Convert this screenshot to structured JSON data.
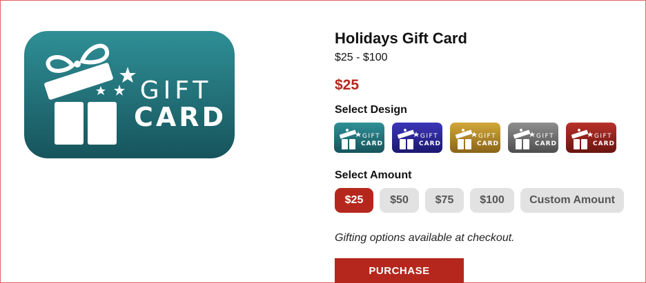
{
  "product": {
    "title": "Holidays Gift Card",
    "price_range": "$25 - $100",
    "selected_price": "$25"
  },
  "card_text": {
    "line1": "GIFT",
    "line2": "CARD"
  },
  "design_section": {
    "label": "Select Design",
    "designs": [
      {
        "name": "teal",
        "color_top": "#2f8f96",
        "color_bottom": "#17545c"
      },
      {
        "name": "indigo",
        "color_top": "#3b36b8",
        "color_bottom": "#1c1870"
      },
      {
        "name": "gold",
        "color_top": "#d2a73a",
        "color_bottom": "#8a6418"
      },
      {
        "name": "gray",
        "color_top": "#8e8e8e",
        "color_bottom": "#4e4e4e"
      },
      {
        "name": "red",
        "color_top": "#b8322a",
        "color_bottom": "#6a1410"
      }
    ]
  },
  "amount_section": {
    "label": "Select Amount",
    "options": [
      {
        "label": "$25",
        "selected": true
      },
      {
        "label": "$50",
        "selected": false
      },
      {
        "label": "$75",
        "selected": false
      },
      {
        "label": "$100",
        "selected": false
      },
      {
        "label": "Custom Amount",
        "selected": false
      }
    ]
  },
  "gifting_note": "Gifting options available at checkout.",
  "purchase_label": "PURCHASE",
  "colors": {
    "accent": "#b5271c",
    "hero_top": "#2f8f96",
    "hero_bottom": "#17545c",
    "option_bg": "#e2e2e2"
  }
}
